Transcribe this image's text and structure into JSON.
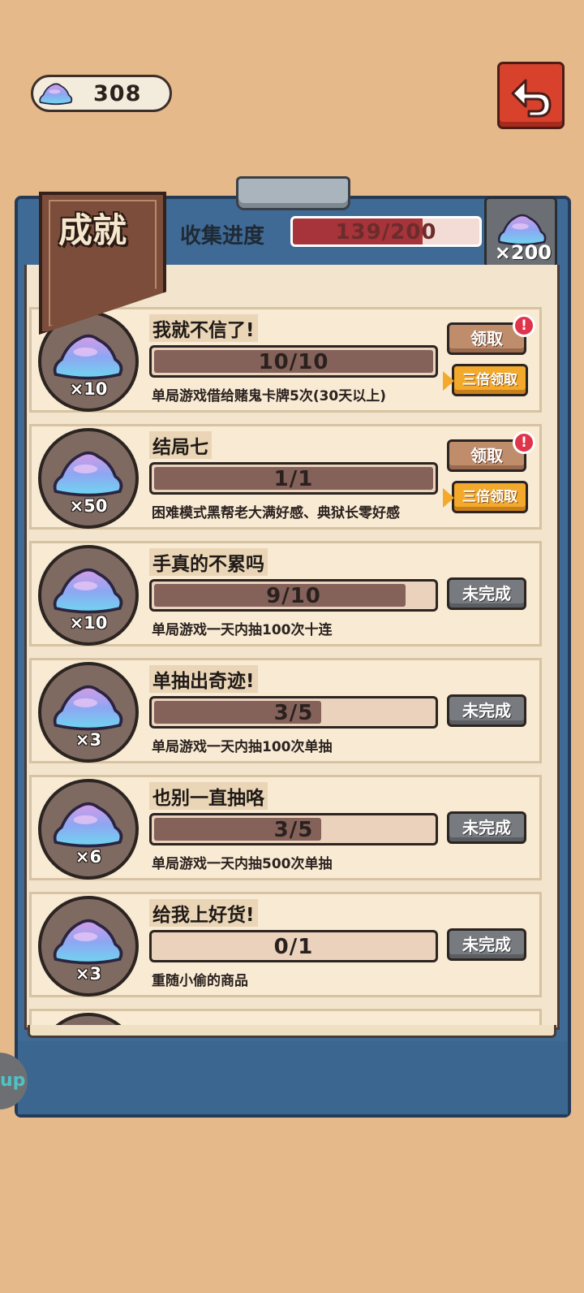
{
  "currency": {
    "amount": "308",
    "icon": "crystal-gem-icon"
  },
  "header": {
    "title": "成就",
    "collect_label": "收集进度",
    "collect_progress_text": "139/200",
    "collect_progress_fraction": 0.695,
    "reward_qty": "×200"
  },
  "side_handle": {
    "label": "up"
  },
  "achievements": [
    {
      "name": "我就不信了!",
      "progress": "10/10",
      "fraction": 1.0,
      "desc": "单局游戏借给赌鬼卡牌5次(30天以上)",
      "reward": "×10",
      "status": "claimable",
      "claim_label": "领取",
      "triple_label": "三倍领取",
      "alert": "!"
    },
    {
      "name": "结局七",
      "progress": "1/1",
      "fraction": 1.0,
      "desc": "困难模式黑帮老大满好感、典狱长零好感",
      "reward": "×50",
      "status": "claimable",
      "claim_label": "领取",
      "triple_label": "三倍领取",
      "alert": "!"
    },
    {
      "name": "手真的不累吗",
      "progress": "9/10",
      "fraction": 0.9,
      "desc": "单局游戏一天内抽100次十连",
      "reward": "×10",
      "status": "incomplete",
      "undone_label": "未完成"
    },
    {
      "name": "单抽出奇迹!",
      "progress": "3/5",
      "fraction": 0.6,
      "desc": "单局游戏一天内抽100次单抽",
      "reward": "×3",
      "status": "incomplete",
      "undone_label": "未完成"
    },
    {
      "name": "也别一直抽咯",
      "progress": "3/5",
      "fraction": 0.6,
      "desc": "单局游戏一天内抽500次单抽",
      "reward": "×6",
      "status": "incomplete",
      "undone_label": "未完成"
    },
    {
      "name": "给我上好货!",
      "progress": "0/1",
      "fraction": 0.0,
      "desc": "重随小偷的商品",
      "reward": "×3",
      "status": "incomplete",
      "undone_label": "未完成"
    }
  ],
  "colors": {
    "accent_red": "#d8412c",
    "board_blue": "#3f6a96",
    "progress_brown": "#84625a",
    "triple_orange": "#f2a92c"
  }
}
